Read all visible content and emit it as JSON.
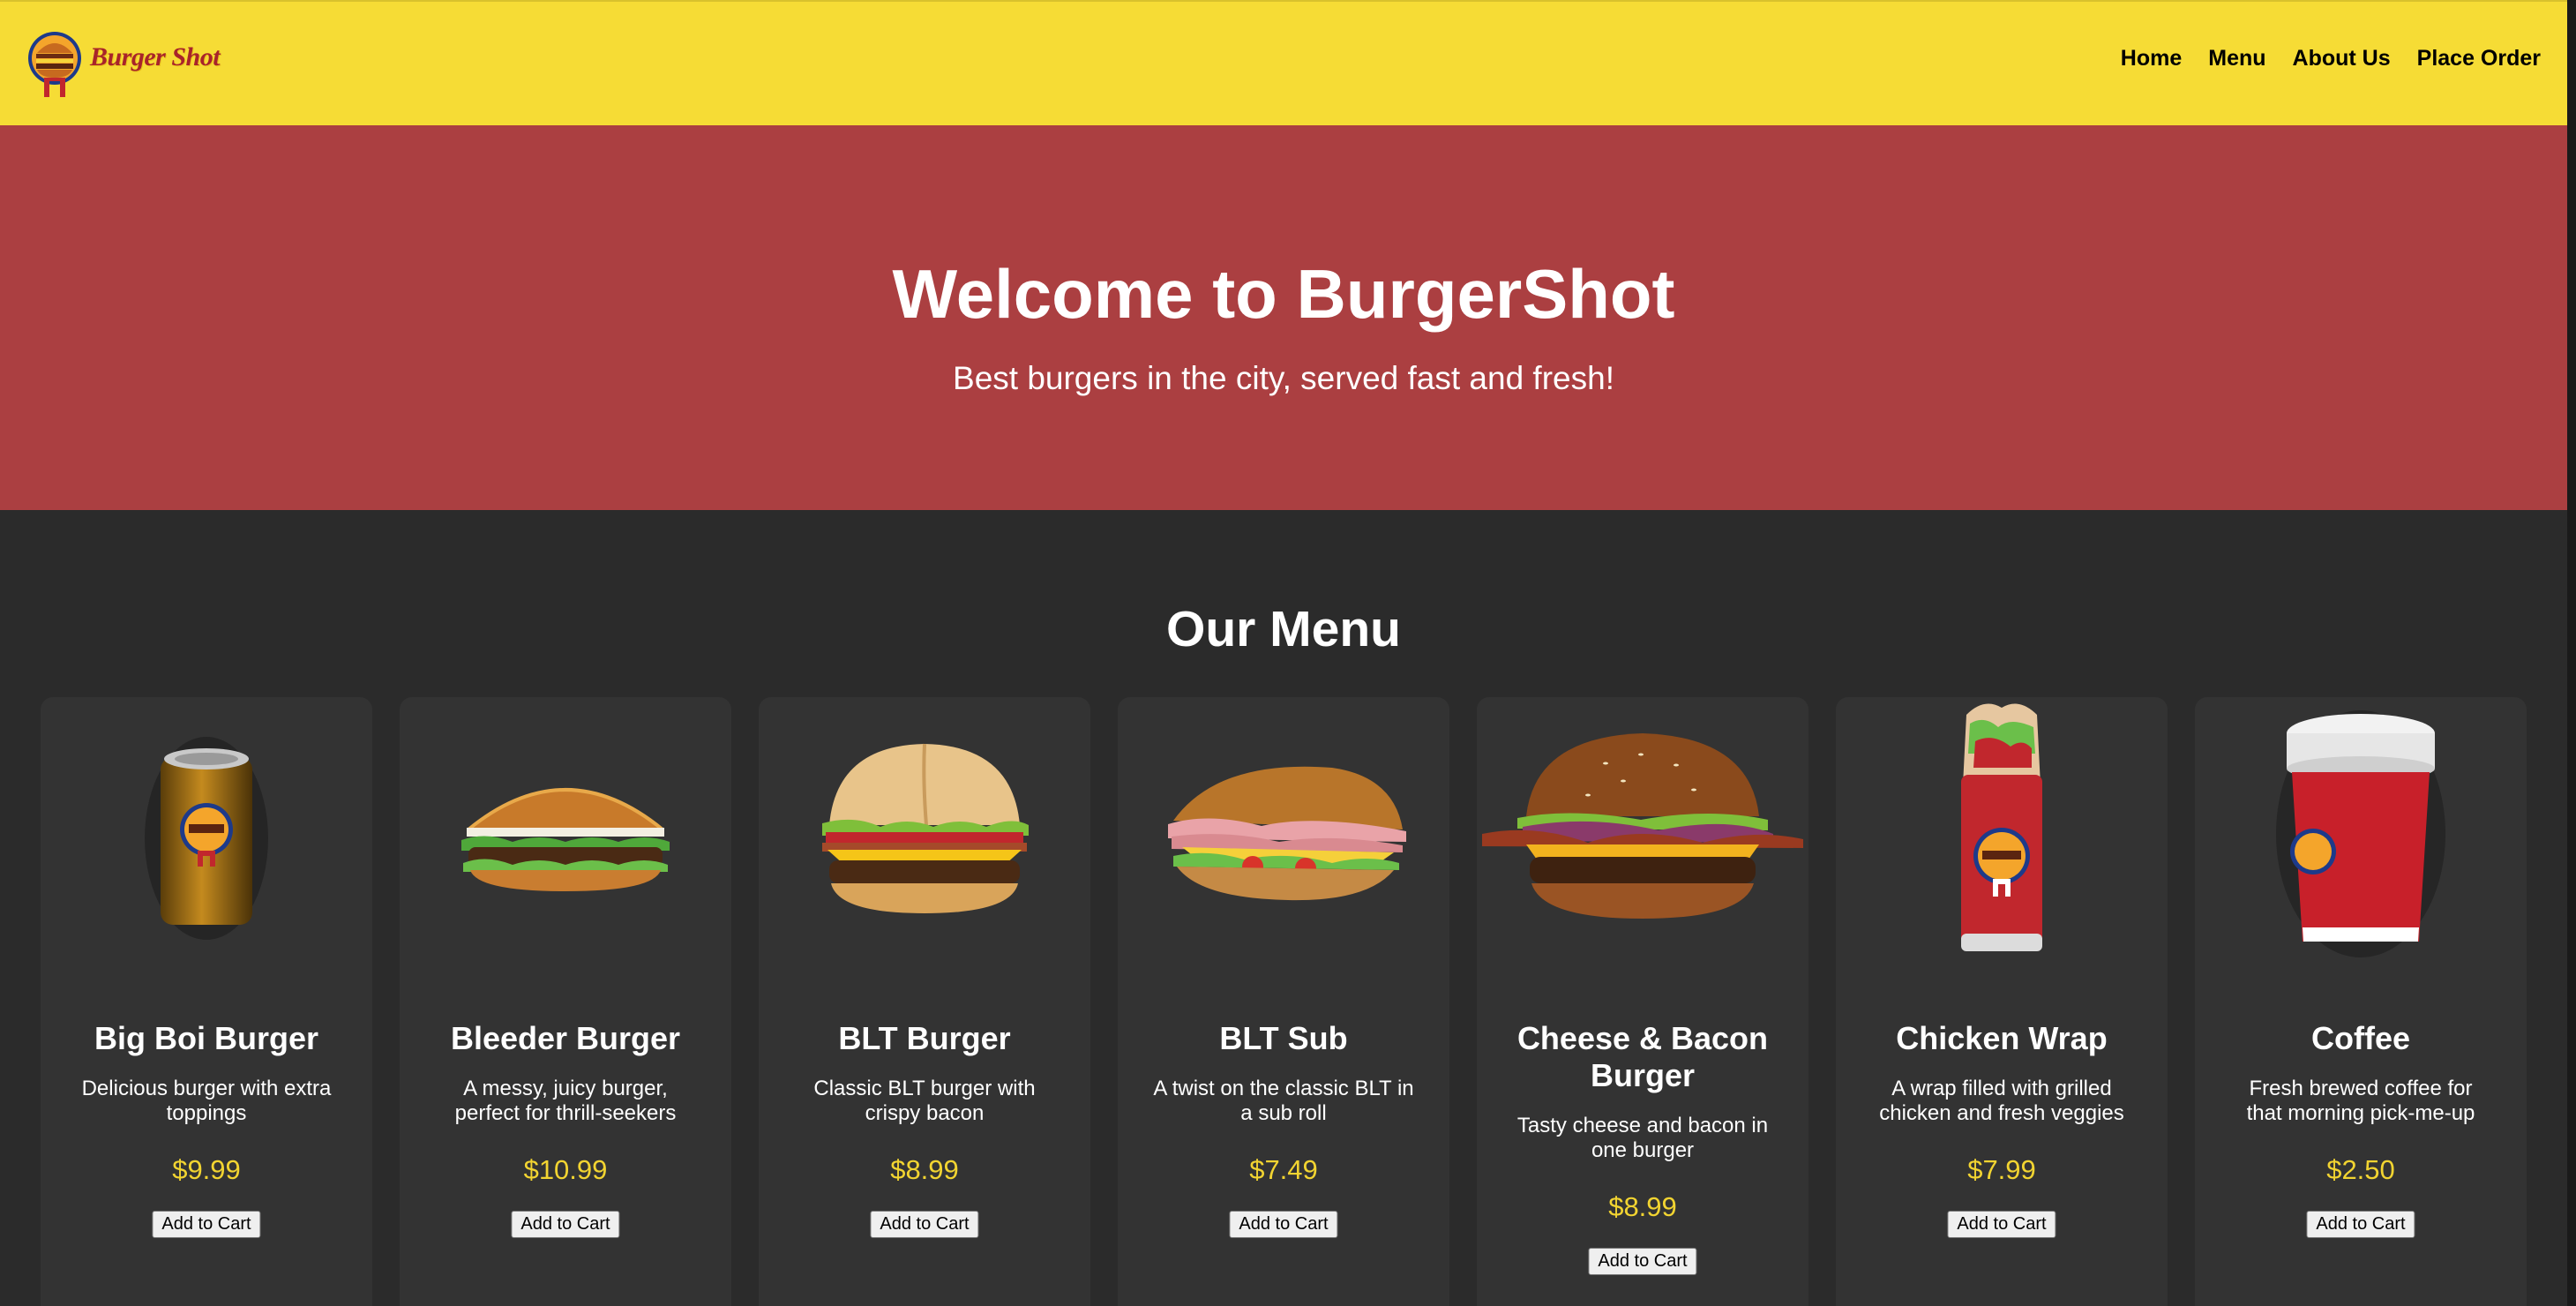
{
  "header": {
    "logo_text": "Burger Shot",
    "nav": [
      "Home",
      "Menu",
      "About Us",
      "Place Order"
    ]
  },
  "hero": {
    "title": "Welcome to BurgerShot",
    "subtitle": "Best burgers in the city, served fast and fresh!"
  },
  "menu": {
    "title": "Our Menu",
    "add_label": "Add to Cart",
    "items": [
      {
        "name": "Big Boi Burger",
        "desc": "Delicious burger with extra toppings",
        "price": "$9.99",
        "image": "soda-can-image"
      },
      {
        "name": "Bleeder Burger",
        "desc": "A messy, juicy burger, perfect for thrill-seekers",
        "price": "$10.99",
        "image": "burger-image"
      },
      {
        "name": "BLT Burger",
        "desc": "Classic BLT burger with crispy bacon",
        "price": "$8.99",
        "image": "blt-burger-image"
      },
      {
        "name": "BLT Sub",
        "desc": "A twist on the classic BLT in a sub roll",
        "price": "$7.49",
        "image": "sub-sandwich-image"
      },
      {
        "name": "Cheese & Bacon Burger",
        "desc": "Tasty cheese and bacon in one burger",
        "price": "$8.99",
        "image": "cheese-bacon-burger-image"
      },
      {
        "name": "Chicken Wrap",
        "desc": "A wrap filled with grilled chicken and fresh veggies",
        "price": "$7.99",
        "image": "wrap-image"
      },
      {
        "name": "Coffee",
        "desc": "Fresh brewed coffee for that morning pick-me-up",
        "price": "$2.50",
        "image": "coffee-cup-image"
      }
    ]
  },
  "colors": {
    "header": "#f6dc35",
    "hero": "#ab3f41",
    "background": "#2b2b2b",
    "card": "#333333",
    "price": "#f2d431"
  }
}
